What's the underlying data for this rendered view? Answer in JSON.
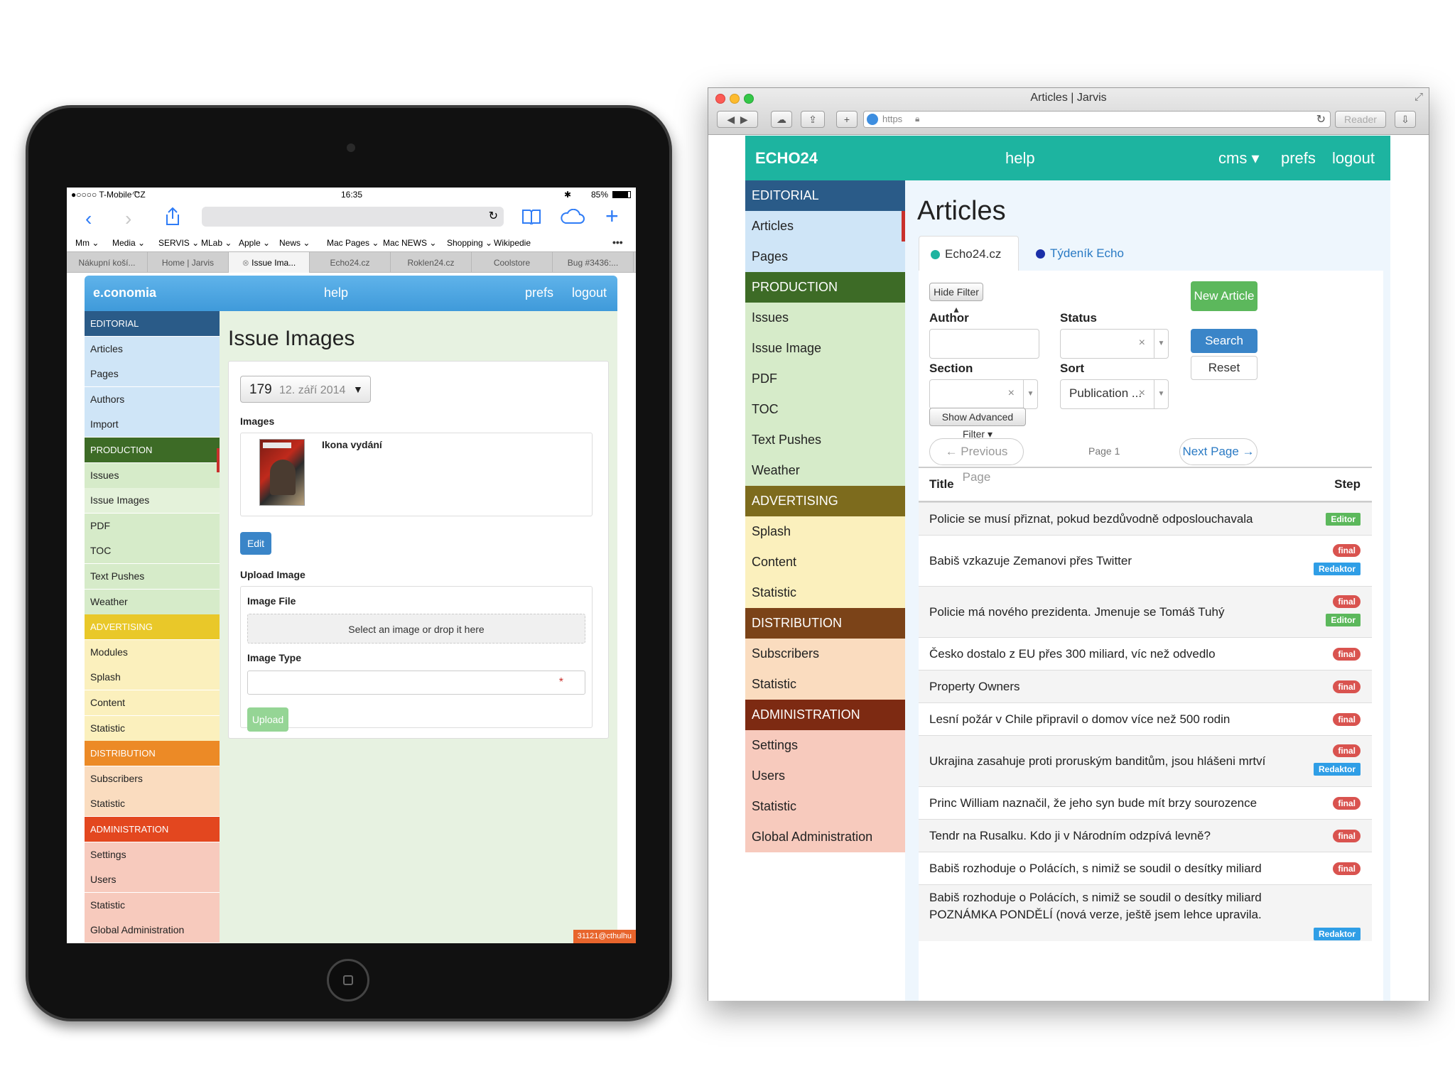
{
  "ipad": {
    "status": {
      "carrier": "●○○○○ T-Mobile CZ",
      "time": "16:35",
      "battery": "85%"
    },
    "bookmarks": [
      "Mm ⌄",
      "Media ⌄",
      "SERVIS ⌄",
      "MLab ⌄",
      "Apple ⌄",
      "News ⌄",
      "Mac Pages ⌄",
      "Mac NEWS ⌄",
      "Shopping ⌄",
      "Wikipedie"
    ],
    "tabs": [
      "Nákupní koší...",
      "Home | Jarvis",
      "Issue Ima...",
      "Echo24.cz",
      "Roklen24.cz",
      "Coolstore",
      "Bug #3436:..."
    ],
    "nav": {
      "brand": "e.conomia",
      "help": "help",
      "prefs": "prefs",
      "logout": "logout"
    },
    "sidebar": [
      {
        "label": "EDITORIAL",
        "type": "head",
        "color": "#2a5b88"
      },
      {
        "label": "Articles",
        "color": "#cfe5f7"
      },
      {
        "label": "Pages",
        "color": "#cfe5f7"
      },
      {
        "label": "Authors",
        "color": "#cfe5f7"
      },
      {
        "label": "Import",
        "color": "#cfe5f7"
      },
      {
        "label": "PRODUCTION",
        "type": "head",
        "color": "#3d6b26"
      },
      {
        "label": "Issues",
        "color": "#d6ebc9"
      },
      {
        "label": "Issue Images",
        "color": "#e4f2da"
      },
      {
        "label": "PDF",
        "color": "#d6ebc9"
      },
      {
        "label": "TOC",
        "color": "#d6ebc9"
      },
      {
        "label": "Text Pushes",
        "color": "#d6ebc9"
      },
      {
        "label": "Weather",
        "color": "#d6ebc9"
      },
      {
        "label": "ADVERTISING",
        "type": "head",
        "color": "#e9c829"
      },
      {
        "label": "Modules",
        "color": "#fbf0bd"
      },
      {
        "label": "Splash",
        "color": "#fbf0bd"
      },
      {
        "label": "Content",
        "color": "#fbf0bd"
      },
      {
        "label": "Statistic",
        "color": "#fbf0bd"
      },
      {
        "label": "DISTRIBUTION",
        "type": "head",
        "color": "#ec8a26"
      },
      {
        "label": "Subscribers",
        "color": "#fadcbf"
      },
      {
        "label": "Statistic",
        "color": "#fadcbf"
      },
      {
        "label": "ADMINISTRATION",
        "type": "head",
        "color": "#e3471f"
      },
      {
        "label": "Settings",
        "color": "#f7cabd"
      },
      {
        "label": "Users",
        "color": "#f7cabd"
      },
      {
        "label": "Statistic",
        "color": "#f7cabd"
      },
      {
        "label": "Global Administration",
        "color": "#f7cabd"
      }
    ],
    "page": {
      "title": "Issue Images",
      "issue_number": "179",
      "issue_date": "12. září 2014",
      "images_label": "Images",
      "image_caption": "Ikona vydání",
      "edit_label": "Edit",
      "upload_heading": "Upload Image",
      "image_file_label": "Image File",
      "dropzone_text": "Select an image or drop it here",
      "image_type_label": "Image Type",
      "required_mark": "*",
      "upload_label": "Upload",
      "user_badge": "31121@cthulhu"
    }
  },
  "mac": {
    "window_title": "Articles | Jarvis",
    "url_scheme": "https",
    "reader_label": "Reader",
    "nav": {
      "brand": "ECHO24",
      "help": "help",
      "cms": "cms ▾",
      "prefs": "prefs",
      "logout": "logout"
    },
    "sidebar": [
      {
        "label": "EDITORIAL",
        "type": "head",
        "color": "#2a5b88"
      },
      {
        "label": "Articles",
        "color": "#cfe5f7"
      },
      {
        "label": "Pages",
        "color": "#cfe5f7"
      },
      {
        "label": "PRODUCTION",
        "type": "head",
        "color": "#3d6b26"
      },
      {
        "label": "Issues",
        "color": "#d6ebc9"
      },
      {
        "label": "Issue Image",
        "color": "#d6ebc9"
      },
      {
        "label": "PDF",
        "color": "#d6ebc9"
      },
      {
        "label": "TOC",
        "color": "#d6ebc9"
      },
      {
        "label": "Text Pushes",
        "color": "#d6ebc9"
      },
      {
        "label": "Weather",
        "color": "#d6ebc9"
      },
      {
        "label": "ADVERTISING",
        "type": "head",
        "color": "#7d6b1d"
      },
      {
        "label": "Splash",
        "color": "#fbf0bd"
      },
      {
        "label": "Content",
        "color": "#fbf0bd"
      },
      {
        "label": "Statistic",
        "color": "#fbf0bd"
      },
      {
        "label": "DISTRIBUTION",
        "type": "head",
        "color": "#7b4318"
      },
      {
        "label": "Subscribers",
        "color": "#fadcbf"
      },
      {
        "label": "Statistic",
        "color": "#fadcbf"
      },
      {
        "label": "ADMINISTRATION",
        "type": "head",
        "color": "#7d2a12"
      },
      {
        "label": "Settings",
        "color": "#f7cabd"
      },
      {
        "label": "Users",
        "color": "#f7cabd"
      },
      {
        "label": "Statistic",
        "color": "#f7cabd"
      },
      {
        "label": "Global Administration",
        "color": "#f7cabd"
      }
    ],
    "page": {
      "title": "Articles",
      "tabs": [
        {
          "label": "Echo24.cz",
          "dot": "#1db4a0"
        },
        {
          "label": "Týdeník Echo",
          "dot": "#1b2fa8"
        }
      ],
      "hide_filter": "Hide Filter ▴",
      "new_article": "New Article",
      "author_label": "Author",
      "status_label": "Status",
      "section_label": "Section",
      "sort_label": "Sort",
      "sort_value": "Publication ...",
      "search": "Search",
      "reset": "Reset",
      "advanced_filter": "Show Advanced Filter ▾",
      "prev_page": "← Previous Page",
      "page_label": "Page 1",
      "next_page": "Next Page →",
      "col_title": "Title",
      "col_step": "Step",
      "articles": [
        {
          "title": "Policie se musí přiznat, pokud bezdůvodně odposlouchavala",
          "labels": [
            "Editor"
          ]
        },
        {
          "title": "Babiš vzkazuje Zemanovi přes Twitter",
          "labels": [
            "final",
            "Redaktor"
          ]
        },
        {
          "title": "Policie má nového prezidenta. Jmenuje se Tomáš Tuhý",
          "labels": [
            "final",
            "Editor"
          ]
        },
        {
          "title": "Česko dostalo z EU přes 300 miliard, víc než odvedlo",
          "labels": [
            "final"
          ]
        },
        {
          "title": "Property Owners",
          "labels": [
            "final"
          ]
        },
        {
          "title": "Lesní požár v Chile připravil o domov více než 500 rodin",
          "labels": [
            "final"
          ]
        },
        {
          "title": "Ukrajina zasahuje proti proruským banditům, jsou hlášeni mrtví",
          "labels": [
            "final",
            "Redaktor"
          ]
        },
        {
          "title": "Princ William naznačil, že jeho syn bude mít brzy sourozence",
          "labels": [
            "final"
          ]
        },
        {
          "title": "Tendr na Rusalku. Kdo ji v Národním odzpívá levně?",
          "labels": [
            "final"
          ]
        },
        {
          "title": "Babiš rozhoduje o Polácích, s nimiž se soudil o desítky miliard",
          "labels": [
            "final"
          ]
        },
        {
          "title": "Babiš rozhoduje o Polácích, s nimiž se soudil o desítky miliard POZNÁMKA PONDĚLÍ (nová verze, ještě jsem lehce upravila.",
          "labels": [
            "Redaktor"
          ]
        }
      ]
    }
  }
}
